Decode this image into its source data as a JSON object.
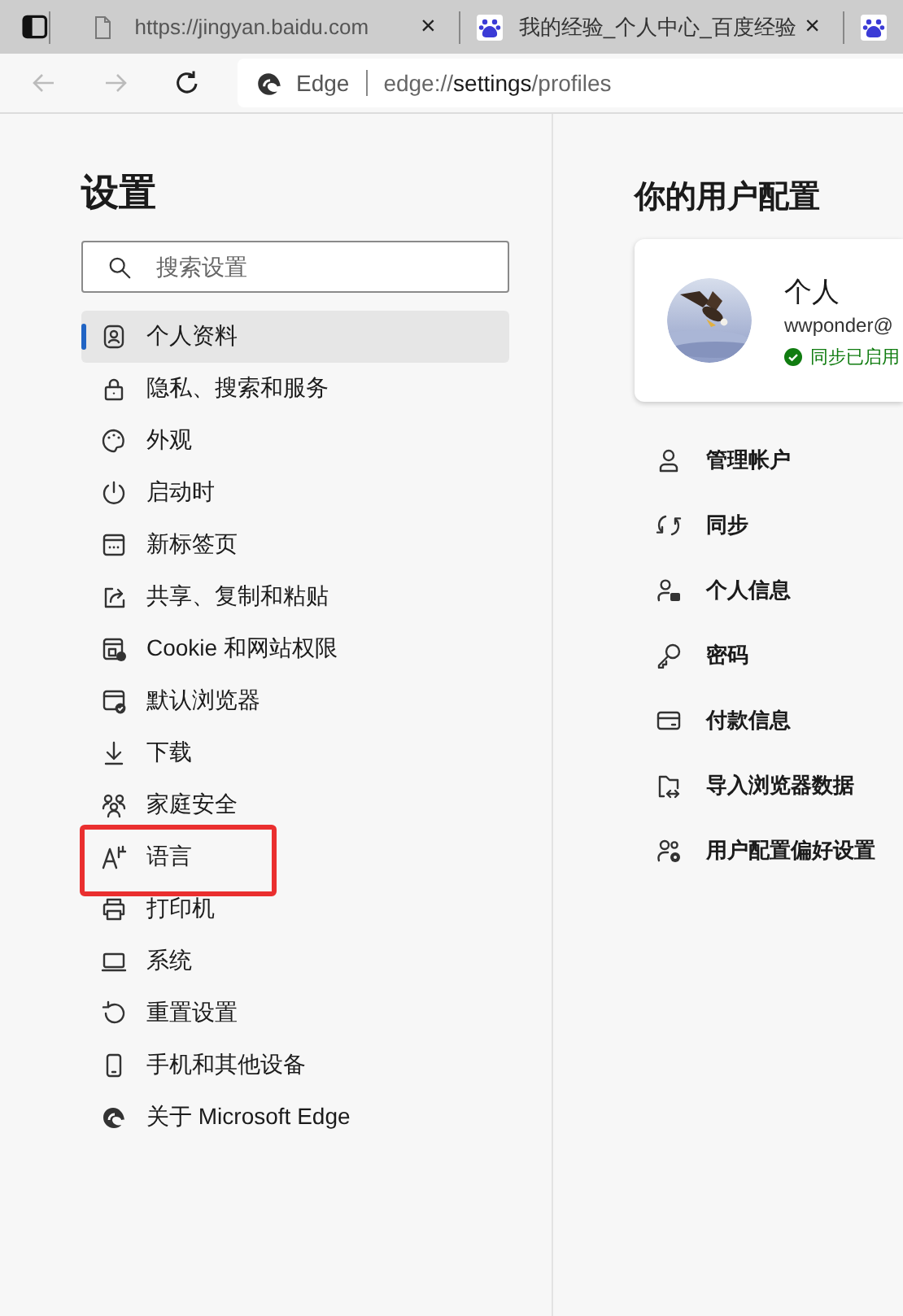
{
  "browser_tabs": [
    {
      "title": "https://jingyan.baidu.com",
      "kind": "page",
      "close": "×"
    },
    {
      "title": "我的经验_个人中心_百度经验",
      "kind": "paw",
      "close": "×"
    },
    {
      "kind": "paw-partial"
    }
  ],
  "address_bar": {
    "back_disabled": true,
    "forward_disabled": true,
    "label": "Edge",
    "url_scheme": "edge://",
    "url_host": "settings",
    "url_path": "/profiles"
  },
  "sidebar": {
    "title": "设置",
    "search": {
      "placeholder": "搜索设置"
    },
    "items": [
      {
        "label": "个人资料",
        "selected": true,
        "highlighted": false
      },
      {
        "label": "隐私、搜索和服务",
        "selected": false,
        "highlighted": false
      },
      {
        "label": "外观",
        "selected": false,
        "highlighted": false
      },
      {
        "label": "启动时",
        "selected": false,
        "highlighted": false
      },
      {
        "label": "新标签页",
        "selected": false,
        "highlighted": false
      },
      {
        "label": "共享、复制和粘贴",
        "selected": false,
        "highlighted": false
      },
      {
        "label": "Cookie 和网站权限",
        "selected": false,
        "highlighted": false
      },
      {
        "label": "默认浏览器",
        "selected": false,
        "highlighted": false
      },
      {
        "label": "下载",
        "selected": false,
        "highlighted": false
      },
      {
        "label": "家庭安全",
        "selected": false,
        "highlighted": false
      },
      {
        "label": "语言",
        "selected": false,
        "highlighted": true
      },
      {
        "label": "打印机",
        "selected": false,
        "highlighted": false
      },
      {
        "label": "系统",
        "selected": false,
        "highlighted": false
      },
      {
        "label": "重置设置",
        "selected": false,
        "highlighted": false
      },
      {
        "label": "手机和其他设备",
        "selected": false,
        "highlighted": false
      },
      {
        "label": "关于 Microsoft Edge",
        "selected": false,
        "highlighted": false
      }
    ]
  },
  "profile": {
    "title": "你的用户配置",
    "card": {
      "name": "个人",
      "email": "wwponder@",
      "sync_status": "同步已启用"
    },
    "items": [
      {
        "label": "管理帐户"
      },
      {
        "label": "同步"
      },
      {
        "label": "个人信息"
      },
      {
        "label": "密码"
      },
      {
        "label": "付款信息"
      },
      {
        "label": "导入浏览器数据"
      },
      {
        "label": "用户配置偏好设置"
      }
    ]
  }
}
